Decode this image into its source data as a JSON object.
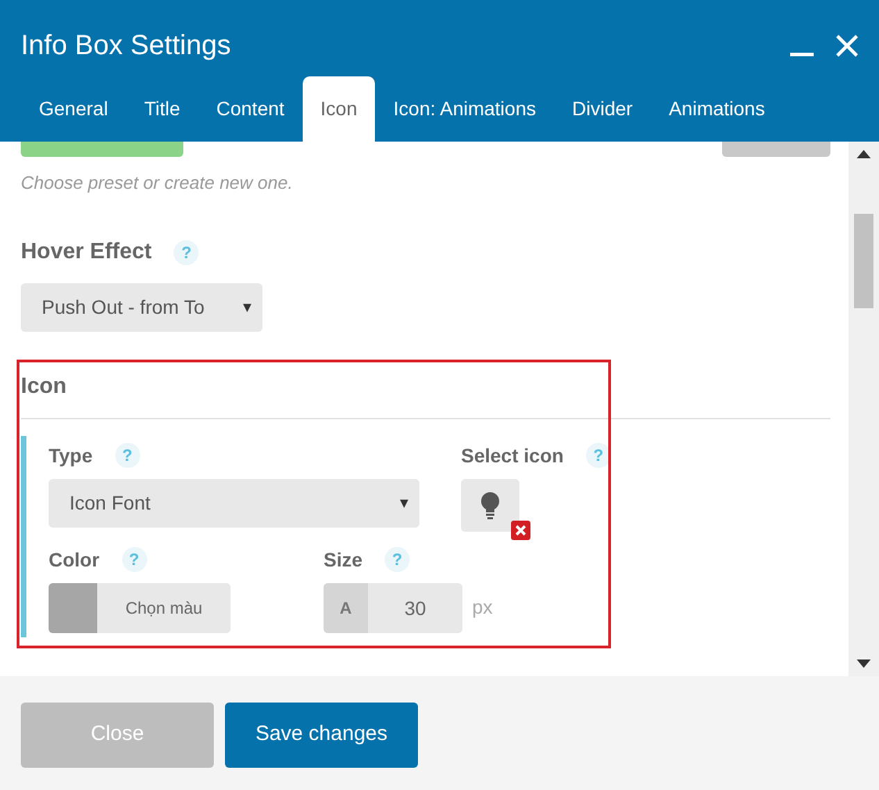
{
  "window": {
    "title": "Info Box Settings"
  },
  "tabs": [
    {
      "label": "General",
      "selected": false
    },
    {
      "label": "Title",
      "selected": false
    },
    {
      "label": "Content",
      "selected": false
    },
    {
      "label": "Icon",
      "selected": true
    },
    {
      "label": "Icon: Animations",
      "selected": false
    },
    {
      "label": "Divider",
      "selected": false
    },
    {
      "label": "Animations",
      "selected": false
    }
  ],
  "preset": {
    "hint": "Choose preset or create new one."
  },
  "hover_effect": {
    "label": "Hover Effect",
    "help": "?",
    "value": "Push Out - from To",
    "caret": "▾"
  },
  "icon_section": {
    "heading": "Icon",
    "type": {
      "label": "Type",
      "help": "?",
      "value": "Icon Font",
      "caret": "▾"
    },
    "select_icon": {
      "label": "Select icon",
      "help": "?"
    },
    "color": {
      "label": "Color",
      "help": "?",
      "button": "Chọn màu"
    },
    "size": {
      "label": "Size",
      "help": "?",
      "addon": "A",
      "value": "30",
      "unit": "px"
    }
  },
  "buttons": [
    {
      "label": "Close",
      "kind": "secondary"
    },
    {
      "label": "Save changes",
      "kind": "primary"
    }
  ]
}
